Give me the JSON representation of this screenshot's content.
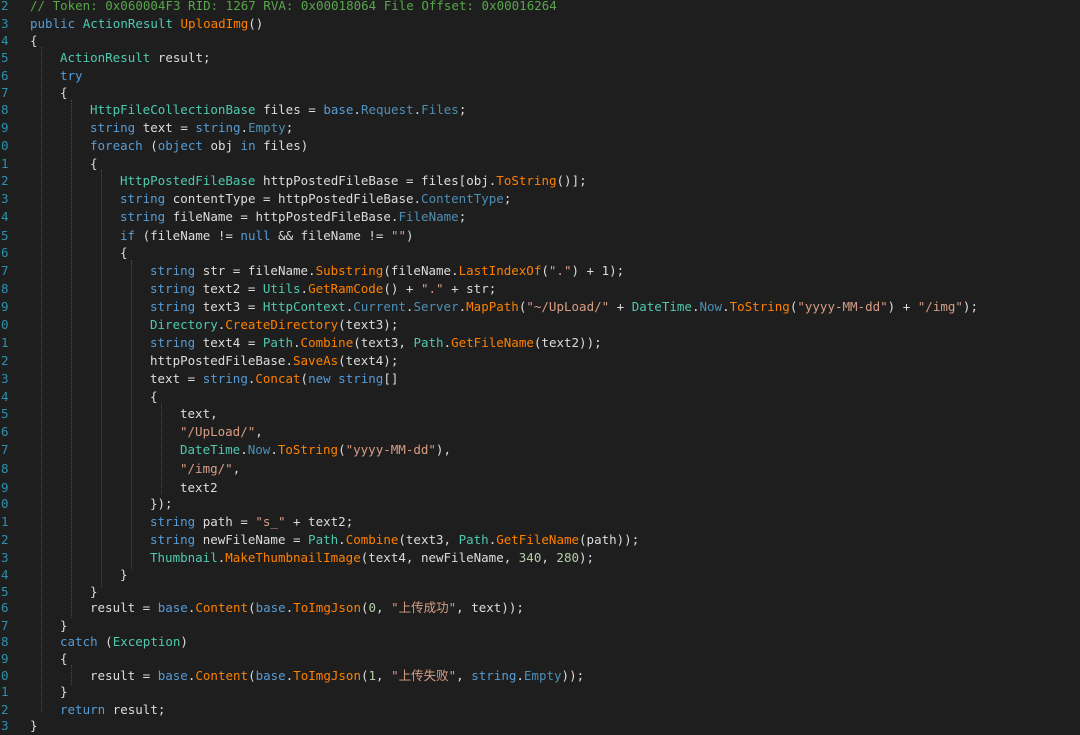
{
  "editor": {
    "lines": [
      {
        "n": "2",
        "indent": 0,
        "tokens": [
          [
            "cm",
            "// Token: 0x060004F3 RID: 1267 RVA: 0x00018064 File Offset: 0x00016264"
          ]
        ]
      },
      {
        "n": "3",
        "indent": 0,
        "tokens": [
          [
            "kw",
            "public "
          ],
          [
            "ty",
            "ActionResult "
          ],
          [
            "mt",
            "UploadImg"
          ],
          [
            "tx",
            "()"
          ]
        ]
      },
      {
        "n": "4",
        "indent": 0,
        "tokens": [
          [
            "tx",
            "{"
          ]
        ]
      },
      {
        "n": "5",
        "indent": 1,
        "tokens": [
          [
            "ty",
            "ActionResult "
          ],
          [
            "tx",
            "result;"
          ]
        ]
      },
      {
        "n": "6",
        "indent": 1,
        "tokens": [
          [
            "kw",
            "try"
          ]
        ]
      },
      {
        "n": "7",
        "indent": 1,
        "tokens": [
          [
            "tx",
            "{"
          ]
        ]
      },
      {
        "n": "8",
        "indent": 2,
        "tokens": [
          [
            "ty",
            "HttpFileCollectionBase "
          ],
          [
            "tx",
            "files = "
          ],
          [
            "kw",
            "base"
          ],
          [
            "tx",
            "."
          ],
          [
            "pr",
            "Request"
          ],
          [
            "tx",
            "."
          ],
          [
            "pr",
            "Files"
          ],
          [
            "tx",
            ";"
          ]
        ]
      },
      {
        "n": "9",
        "indent": 2,
        "tokens": [
          [
            "kw",
            "string "
          ],
          [
            "tx",
            "text = "
          ],
          [
            "kw",
            "string"
          ],
          [
            "tx",
            "."
          ],
          [
            "pr",
            "Empty"
          ],
          [
            "tx",
            ";"
          ]
        ]
      },
      {
        "n": "0",
        "indent": 2,
        "tokens": [
          [
            "kw",
            "foreach "
          ],
          [
            "tx",
            "("
          ],
          [
            "kw",
            "object "
          ],
          [
            "tx",
            "obj "
          ],
          [
            "kw",
            "in "
          ],
          [
            "tx",
            "files)"
          ]
        ]
      },
      {
        "n": "1",
        "indent": 2,
        "tokens": [
          [
            "tx",
            "{"
          ]
        ]
      },
      {
        "n": "2",
        "indent": 3,
        "tokens": [
          [
            "ty",
            "HttpPostedFileBase "
          ],
          [
            "tx",
            "httpPostedFileBase = files[obj."
          ],
          [
            "mt",
            "ToString"
          ],
          [
            "tx",
            "()];"
          ]
        ]
      },
      {
        "n": "3",
        "indent": 3,
        "tokens": [
          [
            "kw",
            "string "
          ],
          [
            "tx",
            "contentType = httpPostedFileBase."
          ],
          [
            "pr",
            "ContentType"
          ],
          [
            "tx",
            ";"
          ]
        ]
      },
      {
        "n": "4",
        "indent": 3,
        "tokens": [
          [
            "kw",
            "string "
          ],
          [
            "tx",
            "fileName = httpPostedFileBase."
          ],
          [
            "pr",
            "FileName"
          ],
          [
            "tx",
            ";"
          ]
        ]
      },
      {
        "n": "5",
        "indent": 3,
        "tokens": [
          [
            "kw",
            "if "
          ],
          [
            "tx",
            "(fileName != "
          ],
          [
            "kw",
            "null "
          ],
          [
            "tx",
            "&& fileName != "
          ],
          [
            "st",
            "\"\""
          ],
          [
            "tx",
            ")"
          ]
        ]
      },
      {
        "n": "6",
        "indent": 3,
        "tokens": [
          [
            "tx",
            "{"
          ]
        ]
      },
      {
        "n": "7",
        "indent": 4,
        "tokens": [
          [
            "kw",
            "string "
          ],
          [
            "tx",
            "str = fileName."
          ],
          [
            "mt",
            "Substring"
          ],
          [
            "tx",
            "(fileName."
          ],
          [
            "mt",
            "LastIndexOf"
          ],
          [
            "tx",
            "("
          ],
          [
            "st",
            "\".\""
          ],
          [
            "tx",
            ") + 1);"
          ]
        ]
      },
      {
        "n": "8",
        "indent": 4,
        "tokens": [
          [
            "kw",
            "string "
          ],
          [
            "tx",
            "text2 = "
          ],
          [
            "ty",
            "Utils"
          ],
          [
            "tx",
            "."
          ],
          [
            "mt",
            "GetRamCode"
          ],
          [
            "tx",
            "() + "
          ],
          [
            "st",
            "\".\""
          ],
          [
            "tx",
            " + str;"
          ]
        ]
      },
      {
        "n": "9",
        "indent": 4,
        "tokens": [
          [
            "kw",
            "string "
          ],
          [
            "tx",
            "text3 = "
          ],
          [
            "ty",
            "HttpContext"
          ],
          [
            "tx",
            "."
          ],
          [
            "pr",
            "Current"
          ],
          [
            "tx",
            "."
          ],
          [
            "pr",
            "Server"
          ],
          [
            "tx",
            "."
          ],
          [
            "mt",
            "MapPath"
          ],
          [
            "tx",
            "("
          ],
          [
            "st",
            "\"~/UpLoad/\""
          ],
          [
            "tx",
            " + "
          ],
          [
            "ty",
            "DateTime"
          ],
          [
            "tx",
            "."
          ],
          [
            "pr",
            "Now"
          ],
          [
            "tx",
            "."
          ],
          [
            "mt",
            "ToString"
          ],
          [
            "tx",
            "("
          ],
          [
            "st",
            "\"yyyy-MM-dd\""
          ],
          [
            "tx",
            ") + "
          ],
          [
            "st",
            "\"/img\""
          ],
          [
            "tx",
            ");"
          ]
        ]
      },
      {
        "n": "0",
        "indent": 4,
        "tokens": [
          [
            "ty",
            "Directory"
          ],
          [
            "tx",
            "."
          ],
          [
            "mt",
            "CreateDirectory"
          ],
          [
            "tx",
            "(text3);"
          ]
        ]
      },
      {
        "n": "1",
        "indent": 4,
        "tokens": [
          [
            "kw",
            "string "
          ],
          [
            "tx",
            "text4 = "
          ],
          [
            "ty",
            "Path"
          ],
          [
            "tx",
            "."
          ],
          [
            "mt",
            "Combine"
          ],
          [
            "tx",
            "(text3, "
          ],
          [
            "ty",
            "Path"
          ],
          [
            "tx",
            "."
          ],
          [
            "mt",
            "GetFileName"
          ],
          [
            "tx",
            "(text2));"
          ]
        ]
      },
      {
        "n": "2",
        "indent": 4,
        "tokens": [
          [
            "tx",
            "httpPostedFileBase."
          ],
          [
            "mt",
            "SaveAs"
          ],
          [
            "tx",
            "(text4);"
          ]
        ]
      },
      {
        "n": "3",
        "indent": 4,
        "tokens": [
          [
            "tx",
            "text = "
          ],
          [
            "kw",
            "string"
          ],
          [
            "tx",
            "."
          ],
          [
            "mt",
            "Concat"
          ],
          [
            "tx",
            "("
          ],
          [
            "kw",
            "new "
          ],
          [
            "kw",
            "string"
          ],
          [
            "tx",
            "[]"
          ]
        ]
      },
      {
        "n": "4",
        "indent": 4,
        "tokens": [
          [
            "tx",
            "{"
          ]
        ]
      },
      {
        "n": "5",
        "indent": 5,
        "tokens": [
          [
            "tx",
            "text,"
          ]
        ]
      },
      {
        "n": "6",
        "indent": 5,
        "tokens": [
          [
            "st",
            "\"/UpLoad/\""
          ],
          [
            "tx",
            ","
          ]
        ]
      },
      {
        "n": "7",
        "indent": 5,
        "tokens": [
          [
            "ty",
            "DateTime"
          ],
          [
            "tx",
            "."
          ],
          [
            "pr",
            "Now"
          ],
          [
            "tx",
            "."
          ],
          [
            "mt",
            "ToString"
          ],
          [
            "tx",
            "("
          ],
          [
            "st",
            "\"yyyy-MM-dd\""
          ],
          [
            "tx",
            "),"
          ]
        ]
      },
      {
        "n": "8",
        "indent": 5,
        "tokens": [
          [
            "st",
            "\"/img/\""
          ],
          [
            "tx",
            ","
          ]
        ]
      },
      {
        "n": "9",
        "indent": 5,
        "tokens": [
          [
            "tx",
            "text2"
          ]
        ]
      },
      {
        "n": "0",
        "indent": 4,
        "tokens": [
          [
            "tx",
            "});"
          ]
        ]
      },
      {
        "n": "1",
        "indent": 4,
        "tokens": [
          [
            "kw",
            "string "
          ],
          [
            "tx",
            "path = "
          ],
          [
            "st",
            "\"s_\""
          ],
          [
            "tx",
            " + text2;"
          ]
        ]
      },
      {
        "n": "2",
        "indent": 4,
        "tokens": [
          [
            "kw",
            "string "
          ],
          [
            "tx",
            "newFileName = "
          ],
          [
            "ty",
            "Path"
          ],
          [
            "tx",
            "."
          ],
          [
            "mt",
            "Combine"
          ],
          [
            "tx",
            "(text3, "
          ],
          [
            "ty",
            "Path"
          ],
          [
            "tx",
            "."
          ],
          [
            "mt",
            "GetFileName"
          ],
          [
            "tx",
            "(path));"
          ]
        ]
      },
      {
        "n": "3",
        "indent": 4,
        "tokens": [
          [
            "ty",
            "Thumbnail"
          ],
          [
            "tx",
            "."
          ],
          [
            "mt",
            "MakeThumbnailImage"
          ],
          [
            "tx",
            "(text4, newFileName, "
          ],
          [
            "nu",
            "340"
          ],
          [
            "tx",
            ", "
          ],
          [
            "nu",
            "280"
          ],
          [
            "tx",
            ");"
          ]
        ]
      },
      {
        "n": "4",
        "indent": 3,
        "tokens": [
          [
            "tx",
            "}"
          ]
        ]
      },
      {
        "n": "5",
        "indent": 2,
        "tokens": [
          [
            "tx",
            "}"
          ]
        ]
      },
      {
        "n": "6",
        "indent": 2,
        "tokens": [
          [
            "tx",
            "result = "
          ],
          [
            "kw",
            "base"
          ],
          [
            "tx",
            "."
          ],
          [
            "mt",
            "Content"
          ],
          [
            "tx",
            "("
          ],
          [
            "kw",
            "base"
          ],
          [
            "tx",
            "."
          ],
          [
            "mt",
            "ToImgJson"
          ],
          [
            "tx",
            "("
          ],
          [
            "nu",
            "0"
          ],
          [
            "tx",
            ", "
          ],
          [
            "st",
            "\"上传成功\""
          ],
          [
            "tx",
            ", text));"
          ]
        ]
      },
      {
        "n": "7",
        "indent": 1,
        "tokens": [
          [
            "tx",
            "}"
          ]
        ]
      },
      {
        "n": "8",
        "indent": 1,
        "tokens": [
          [
            "kw",
            "catch "
          ],
          [
            "tx",
            "("
          ],
          [
            "ty",
            "Exception"
          ],
          [
            "tx",
            ")"
          ]
        ]
      },
      {
        "n": "9",
        "indent": 1,
        "tokens": [
          [
            "tx",
            "{"
          ]
        ]
      },
      {
        "n": "0",
        "indent": 2,
        "tokens": [
          [
            "tx",
            "result = "
          ],
          [
            "kw",
            "base"
          ],
          [
            "tx",
            "."
          ],
          [
            "mt",
            "Content"
          ],
          [
            "tx",
            "("
          ],
          [
            "kw",
            "base"
          ],
          [
            "tx",
            "."
          ],
          [
            "mt",
            "ToImgJson"
          ],
          [
            "tx",
            "("
          ],
          [
            "nu",
            "1"
          ],
          [
            "tx",
            ", "
          ],
          [
            "st",
            "\"上传失败\""
          ],
          [
            "tx",
            ", "
          ],
          [
            "kw",
            "string"
          ],
          [
            "tx",
            "."
          ],
          [
            "pr",
            "Empty"
          ],
          [
            "tx",
            "));"
          ]
        ]
      },
      {
        "n": "1",
        "indent": 1,
        "tokens": [
          [
            "tx",
            "}"
          ]
        ]
      },
      {
        "n": "2",
        "indent": 1,
        "tokens": [
          [
            "kw",
            "return "
          ],
          [
            "tx",
            "result;"
          ]
        ]
      },
      {
        "n": "3",
        "indent": 0,
        "tokens": [
          [
            "tx",
            "}"
          ]
        ]
      }
    ]
  }
}
